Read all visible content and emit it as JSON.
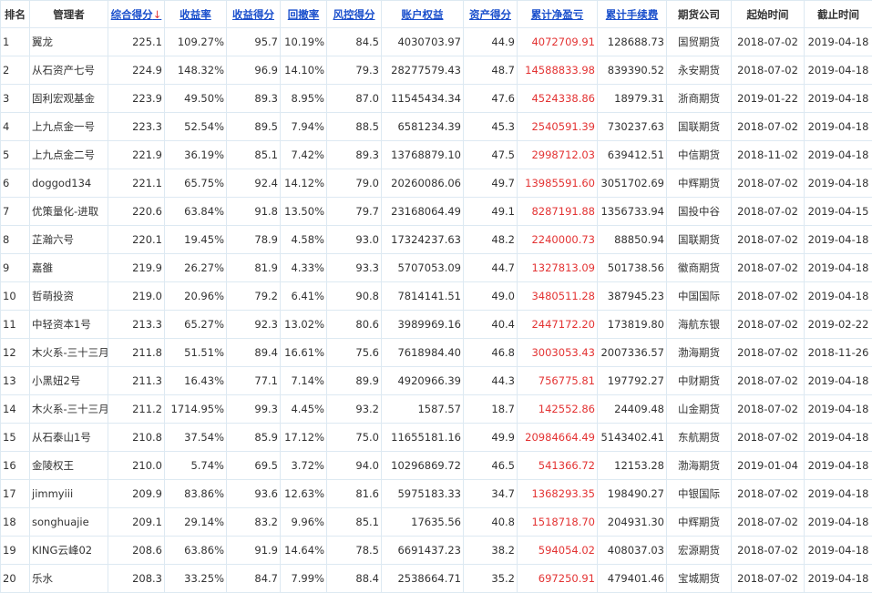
{
  "headers": {
    "rank": "排名",
    "manager": "管理者",
    "total_score": "综合得分",
    "sort_arrow": "↓",
    "return_rate": "收益率",
    "return_score": "收益得分",
    "drawdown": "回撤率",
    "risk_score": "风控得分",
    "equity": "账户权益",
    "asset_score": "资产得分",
    "net_profit": "累计净盈亏",
    "fees": "累计手续费",
    "broker": "期货公司",
    "start": "起始时间",
    "end": "截止时间"
  },
  "colors": {
    "link": "#1a4fcc",
    "profit": "#e33333",
    "border": "#dde9f2"
  },
  "rows": [
    {
      "rank": "1",
      "manager": "翼龙",
      "total_score": "225.1",
      "return_rate": "109.27%",
      "return_score": "95.7",
      "drawdown": "10.19%",
      "risk_score": "84.5",
      "equity": "4030703.97",
      "asset_score": "44.9",
      "net_profit": "4072709.91",
      "fees": "128688.73",
      "broker": "国贸期货",
      "start": "2018-07-02",
      "end": "2019-04-18"
    },
    {
      "rank": "2",
      "manager": "从石资产七号",
      "total_score": "224.9",
      "return_rate": "148.32%",
      "return_score": "96.9",
      "drawdown": "14.10%",
      "risk_score": "79.3",
      "equity": "28277579.43",
      "asset_score": "48.7",
      "net_profit": "14588833.98",
      "fees": "839390.52",
      "broker": "永安期货",
      "start": "2018-07-02",
      "end": "2019-04-18"
    },
    {
      "rank": "3",
      "manager": "固利宏观基金",
      "total_score": "223.9",
      "return_rate": "49.50%",
      "return_score": "89.3",
      "drawdown": "8.95%",
      "risk_score": "87.0",
      "equity": "11545434.34",
      "asset_score": "47.6",
      "net_profit": "4524338.86",
      "fees": "18979.31",
      "broker": "浙商期货",
      "start": "2019-01-22",
      "end": "2019-04-18"
    },
    {
      "rank": "4",
      "manager": "上九点金一号",
      "total_score": "223.3",
      "return_rate": "52.54%",
      "return_score": "89.5",
      "drawdown": "7.94%",
      "risk_score": "88.5",
      "equity": "6581234.39",
      "asset_score": "45.3",
      "net_profit": "2540591.39",
      "fees": "730237.63",
      "broker": "国联期货",
      "start": "2018-07-02",
      "end": "2019-04-18"
    },
    {
      "rank": "5",
      "manager": "上九点金二号",
      "total_score": "221.9",
      "return_rate": "36.19%",
      "return_score": "85.1",
      "drawdown": "7.42%",
      "risk_score": "89.3",
      "equity": "13768879.10",
      "asset_score": "47.5",
      "net_profit": "2998712.03",
      "fees": "639412.51",
      "broker": "中信期货",
      "start": "2018-11-02",
      "end": "2019-04-18"
    },
    {
      "rank": "6",
      "manager": "doggod134",
      "total_score": "221.1",
      "return_rate": "65.75%",
      "return_score": "92.4",
      "drawdown": "14.12%",
      "risk_score": "79.0",
      "equity": "20260086.06",
      "asset_score": "49.7",
      "net_profit": "13985591.60",
      "fees": "3051702.69",
      "broker": "中辉期货",
      "start": "2018-07-02",
      "end": "2019-04-18"
    },
    {
      "rank": "7",
      "manager": "优策量化-进取",
      "total_score": "220.6",
      "return_rate": "63.84%",
      "return_score": "91.8",
      "drawdown": "13.50%",
      "risk_score": "79.7",
      "equity": "23168064.49",
      "asset_score": "49.1",
      "net_profit": "8287191.88",
      "fees": "1356733.94",
      "broker": "国投中谷",
      "start": "2018-07-02",
      "end": "2019-04-15"
    },
    {
      "rank": "8",
      "manager": "芷瀚六号",
      "total_score": "220.1",
      "return_rate": "19.45%",
      "return_score": "78.9",
      "drawdown": "4.58%",
      "risk_score": "93.0",
      "equity": "17324237.63",
      "asset_score": "48.2",
      "net_profit": "2240000.73",
      "fees": "88850.94",
      "broker": "国联期货",
      "start": "2018-07-02",
      "end": "2019-04-18"
    },
    {
      "rank": "9",
      "manager": "嘉雒",
      "total_score": "219.9",
      "return_rate": "26.27%",
      "return_score": "81.9",
      "drawdown": "4.33%",
      "risk_score": "93.3",
      "equity": "5707053.09",
      "asset_score": "44.7",
      "net_profit": "1327813.09",
      "fees": "501738.56",
      "broker": "徽商期货",
      "start": "2018-07-02",
      "end": "2019-04-18"
    },
    {
      "rank": "10",
      "manager": "哲萌投资",
      "total_score": "219.0",
      "return_rate": "20.96%",
      "return_score": "79.2",
      "drawdown": "6.41%",
      "risk_score": "90.8",
      "equity": "7814141.51",
      "asset_score": "49.0",
      "net_profit": "3480511.28",
      "fees": "387945.23",
      "broker": "中国国际",
      "start": "2018-07-02",
      "end": "2019-04-18"
    },
    {
      "rank": "11",
      "manager": "中轻资本1号",
      "total_score": "213.3",
      "return_rate": "65.27%",
      "return_score": "92.3",
      "drawdown": "13.02%",
      "risk_score": "80.6",
      "equity": "3989969.16",
      "asset_score": "40.4",
      "net_profit": "2447172.20",
      "fees": "173819.80",
      "broker": "海航东银",
      "start": "2018-07-02",
      "end": "2019-02-22"
    },
    {
      "rank": "12",
      "manager": "木火系-三十三月",
      "total_score": "211.8",
      "return_rate": "51.51%",
      "return_score": "89.4",
      "drawdown": "16.61%",
      "risk_score": "75.6",
      "equity": "7618984.40",
      "asset_score": "46.8",
      "net_profit": "3003053.43",
      "fees": "2007336.57",
      "broker": "渤海期货",
      "start": "2018-07-02",
      "end": "2018-11-26"
    },
    {
      "rank": "13",
      "manager": "小黑妞2号",
      "total_score": "211.3",
      "return_rate": "16.43%",
      "return_score": "77.1",
      "drawdown": "7.14%",
      "risk_score": "89.9",
      "equity": "4920966.39",
      "asset_score": "44.3",
      "net_profit": "756775.81",
      "fees": "197792.27",
      "broker": "中财期货",
      "start": "2018-07-02",
      "end": "2019-04-18"
    },
    {
      "rank": "14",
      "manager": "木火系-三十三月",
      "total_score": "211.2",
      "return_rate": "1714.95%",
      "return_score": "99.3",
      "drawdown": "4.45%",
      "risk_score": "93.2",
      "equity": "1587.57",
      "asset_score": "18.7",
      "net_profit": "142552.86",
      "fees": "24409.48",
      "broker": "山金期货",
      "start": "2018-07-02",
      "end": "2019-04-18"
    },
    {
      "rank": "15",
      "manager": "从石泰山1号",
      "total_score": "210.8",
      "return_rate": "37.54%",
      "return_score": "85.9",
      "drawdown": "17.12%",
      "risk_score": "75.0",
      "equity": "11655181.16",
      "asset_score": "49.9",
      "net_profit": "20984664.49",
      "fees": "5143402.41",
      "broker": "东航期货",
      "start": "2018-07-02",
      "end": "2019-04-18"
    },
    {
      "rank": "16",
      "manager": "金陵权王",
      "total_score": "210.0",
      "return_rate": "5.74%",
      "return_score": "69.5",
      "drawdown": "3.72%",
      "risk_score": "94.0",
      "equity": "10296869.72",
      "asset_score": "46.5",
      "net_profit": "541366.72",
      "fees": "12153.28",
      "broker": "渤海期货",
      "start": "2019-01-04",
      "end": "2019-04-18"
    },
    {
      "rank": "17",
      "manager": "jimmyiii",
      "total_score": "209.9",
      "return_rate": "83.86%",
      "return_score": "93.6",
      "drawdown": "12.63%",
      "risk_score": "81.6",
      "equity": "5975183.33",
      "asset_score": "34.7",
      "net_profit": "1368293.35",
      "fees": "198490.27",
      "broker": "中银国际",
      "start": "2018-07-02",
      "end": "2019-04-18"
    },
    {
      "rank": "18",
      "manager": "songhuajie",
      "total_score": "209.1",
      "return_rate": "29.14%",
      "return_score": "83.2",
      "drawdown": "9.96%",
      "risk_score": "85.1",
      "equity": "17635.56",
      "asset_score": "40.8",
      "net_profit": "1518718.70",
      "fees": "204931.30",
      "broker": "中辉期货",
      "start": "2018-07-02",
      "end": "2019-04-18"
    },
    {
      "rank": "19",
      "manager": "KING云峰02",
      "total_score": "208.6",
      "return_rate": "63.86%",
      "return_score": "91.9",
      "drawdown": "14.64%",
      "risk_score": "78.5",
      "equity": "6691437.23",
      "asset_score": "38.2",
      "net_profit": "594054.02",
      "fees": "408037.03",
      "broker": "宏源期货",
      "start": "2018-07-02",
      "end": "2019-04-18"
    },
    {
      "rank": "20",
      "manager": "乐水",
      "total_score": "208.3",
      "return_rate": "33.25%",
      "return_score": "84.7",
      "drawdown": "7.99%",
      "risk_score": "88.4",
      "equity": "2538664.71",
      "asset_score": "35.2",
      "net_profit": "697250.91",
      "fees": "479401.46",
      "broker": "宝城期货",
      "start": "2018-07-02",
      "end": "2019-04-18"
    }
  ]
}
